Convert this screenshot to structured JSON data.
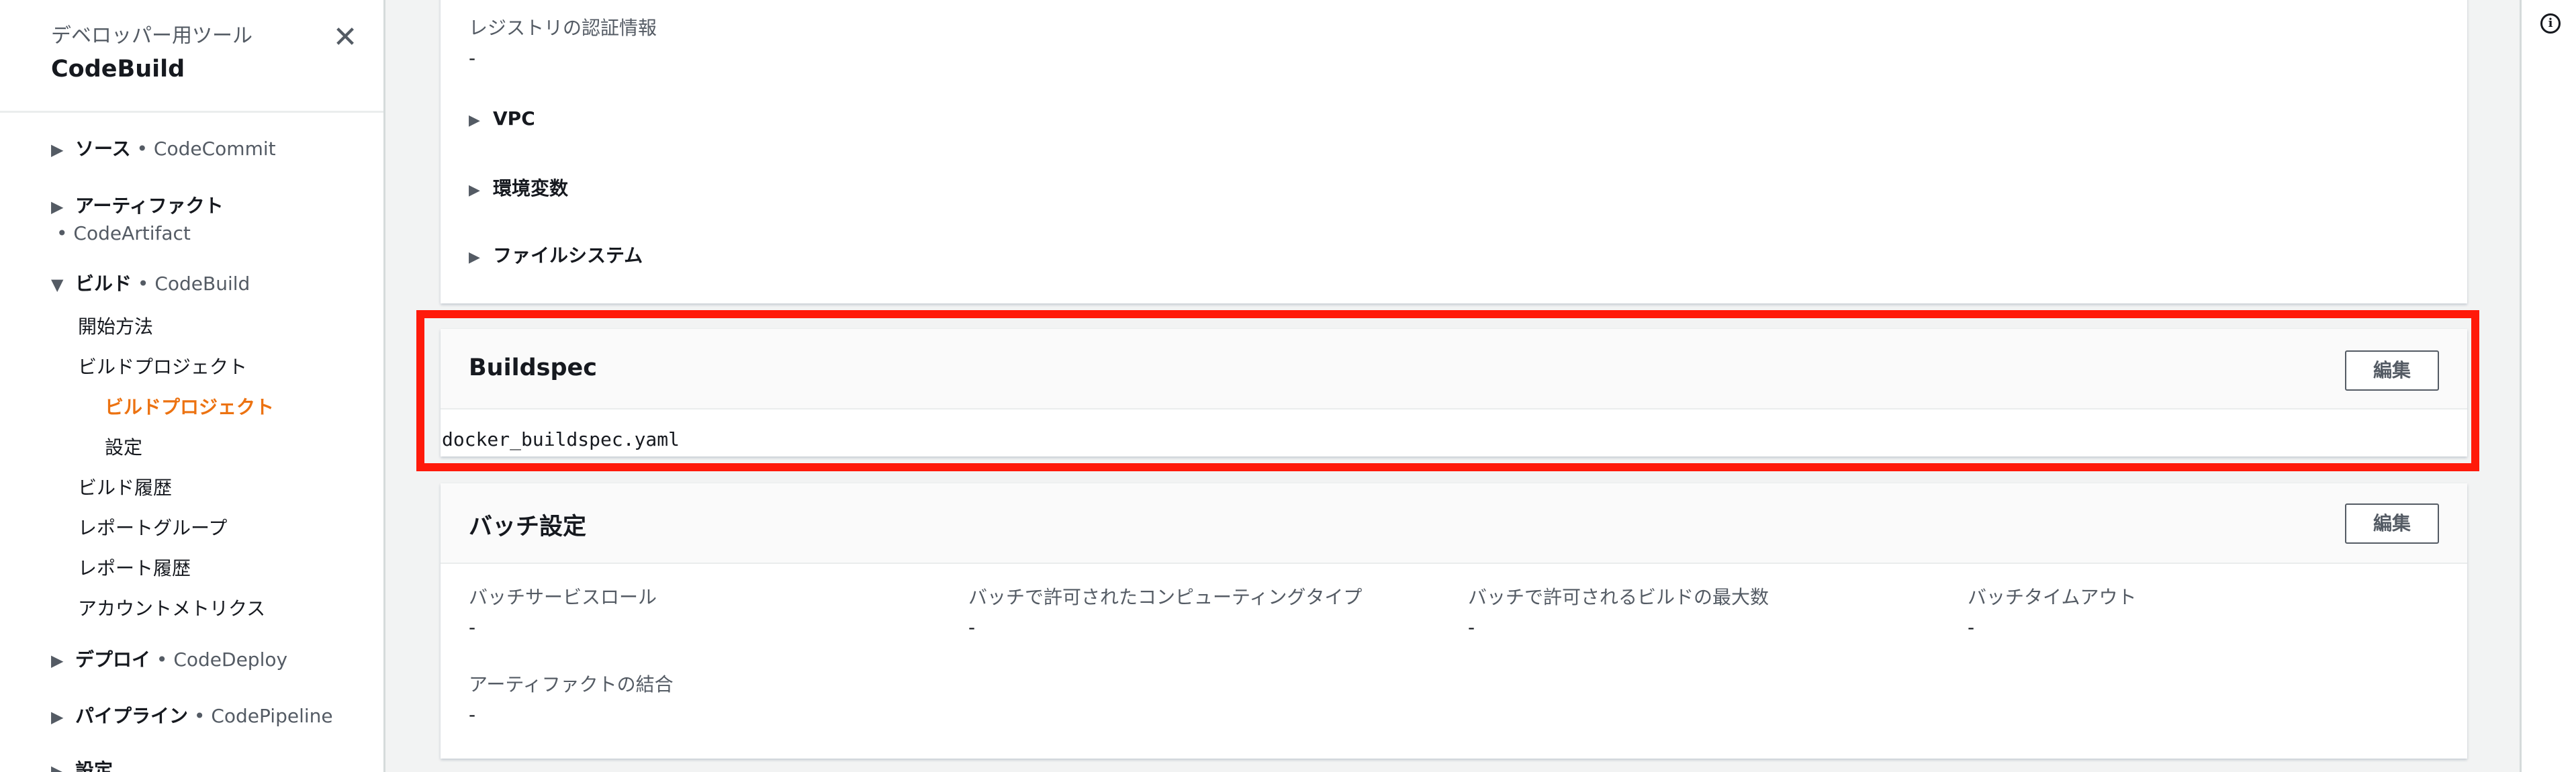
{
  "sidebar": {
    "subtitle": "デベロッパー用ツール",
    "title": "CodeBuild",
    "close_icon": "✕",
    "sections": {
      "source": {
        "label": "ソース",
        "service": "• CodeCommit"
      },
      "artifact": {
        "label": "アーティファクト",
        "service": "• CodeArtifact"
      },
      "build": {
        "label": "ビルド",
        "service": "• CodeBuild"
      },
      "deploy": {
        "label": "デプロイ",
        "service": "• CodeDeploy"
      },
      "pipeline": {
        "label": "パイプライン",
        "service": "• CodePipeline"
      },
      "settings": {
        "label": "設定"
      }
    },
    "build_items": {
      "getting_started": "開始方法",
      "build_projects": "ビルドプロジェクト",
      "build_projects_active": "ビルドプロジェクト",
      "settings": "設定",
      "build_history": "ビルド履歴",
      "report_groups": "レポートグループ",
      "report_history": "レポート履歴",
      "account_metrics": "アカウントメトリクス"
    },
    "arrows": {
      "collapsed": "▶",
      "expanded": "▼"
    }
  },
  "environment": {
    "registry_label": "レジストリの認証情報",
    "registry_value": "-",
    "expanders": {
      "vpc": "VPC",
      "env_vars": "環境変数",
      "file_system": "ファイルシステム"
    }
  },
  "buildspec": {
    "title": "Buildspec",
    "edit_label": "編集",
    "file": "docker_buildspec.yaml"
  },
  "batch": {
    "title": "バッチ設定",
    "edit_label": "編集",
    "fields": {
      "service_role": {
        "label": "バッチサービスロール",
        "value": "-"
      },
      "compute_types": {
        "label": "バッチで許可されたコンピューティングタイプ",
        "value": "-"
      },
      "max_builds": {
        "label": "バッチで許可されるビルドの最大数",
        "value": "-"
      },
      "timeout": {
        "label": "バッチタイムアウト",
        "value": "-"
      },
      "combine_artifacts": {
        "label": "アーティファクトの結合",
        "value": "-"
      }
    }
  },
  "right_rail": {
    "info_icon": "i"
  },
  "colors": {
    "accent": "#ec7211",
    "highlight": "#ff1a0a",
    "background": "#f2f3f3"
  }
}
